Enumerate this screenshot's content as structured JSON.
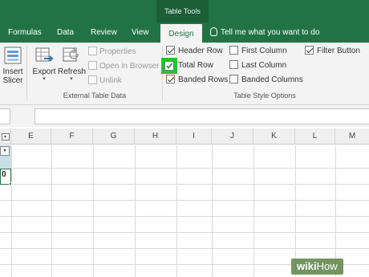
{
  "table_tools": "Table Tools",
  "tabs": [
    {
      "label": "Formulas"
    },
    {
      "label": "Data"
    },
    {
      "label": "Review"
    },
    {
      "label": "View"
    },
    {
      "label": "Design",
      "active": true
    }
  ],
  "tell_me": "Tell me what you want to do",
  "ribbon": {
    "insert_slicer": {
      "line1": "Insert",
      "line2": "Slicer"
    },
    "export": "Export",
    "refresh": "Refresh",
    "properties": "Properties",
    "open_in_browser": "Open in Browser",
    "unlink": "Unlink",
    "external_group_label": "External Table Data",
    "style_options": {
      "header_row": {
        "label": "Header Row",
        "checked": true
      },
      "total_row": {
        "label": "Total Row",
        "checked": true
      },
      "banded_rows": {
        "label": "Banded Rows",
        "checked": true
      },
      "first_column": {
        "label": "First Column",
        "checked": false
      },
      "last_column": {
        "label": "Last Column",
        "checked": false
      },
      "banded_columns": {
        "label": "Banded Columns",
        "checked": false
      },
      "filter_button": {
        "label": "Filter Button",
        "checked": true
      }
    },
    "style_group_label": "Table Style Options"
  },
  "columns": [
    "E",
    "F",
    "G",
    "H",
    "I",
    "J",
    "K",
    "L",
    "M"
  ],
  "total_value": "0",
  "watermark": {
    "wiki": "wiki",
    "how": "How"
  },
  "colors": {
    "accent": "#217346",
    "highlight": "#22c32f",
    "table_band": "#c9dfe6"
  }
}
